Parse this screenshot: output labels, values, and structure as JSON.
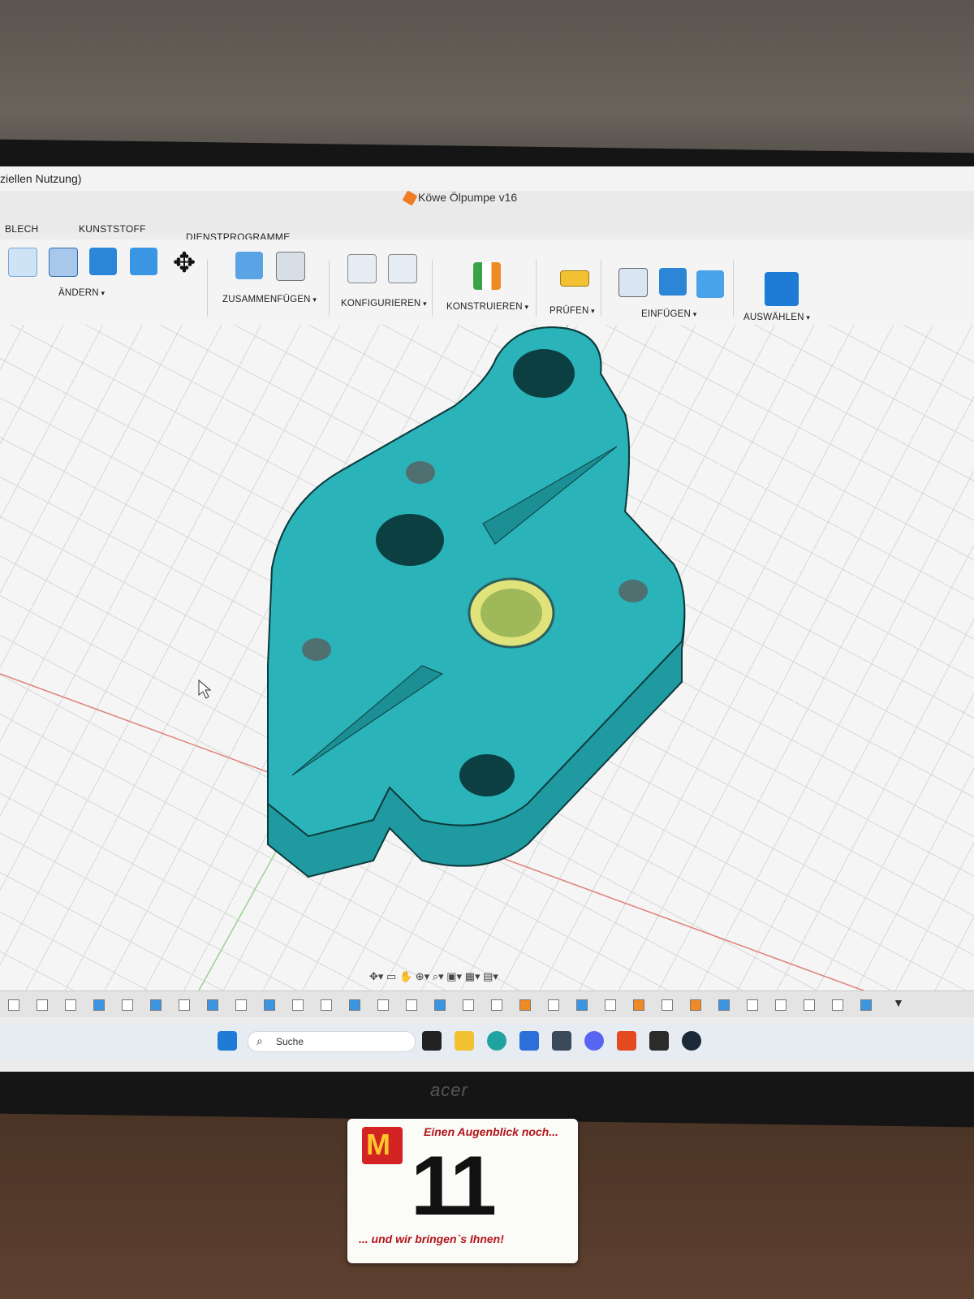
{
  "window": {
    "title_fragment": "ziellen Nutzung)",
    "document_title": "Köwe Ölpumpe v16"
  },
  "tabs": [
    "BLECH",
    "KUNSTSTOFF",
    "DIENSTPROGRAMME"
  ],
  "toolbar_groups": [
    {
      "label": "ÄNDERN"
    },
    {
      "label": "ZUSAMMENFÜGEN"
    },
    {
      "label": "KONFIGURIEREN"
    },
    {
      "label": "KONSTRUIEREN"
    },
    {
      "label": "PRÜFEN"
    },
    {
      "label": "EINFÜGEN"
    },
    {
      "label": "AUSWÄHLEN"
    }
  ],
  "taskbar": {
    "search_placeholder": "Suche"
  },
  "monitor_brand": "acer",
  "order_card": {
    "top_text": "Einen Augenblick noch...",
    "number": "11",
    "bottom_text": "... und wir bringen`s Ihnen!"
  },
  "colors": {
    "model": "#2ab3b8",
    "accent_blue": "#1e7bd6",
    "toolbar_bg": "#f4f4f4",
    "card_red": "#b2141b"
  }
}
